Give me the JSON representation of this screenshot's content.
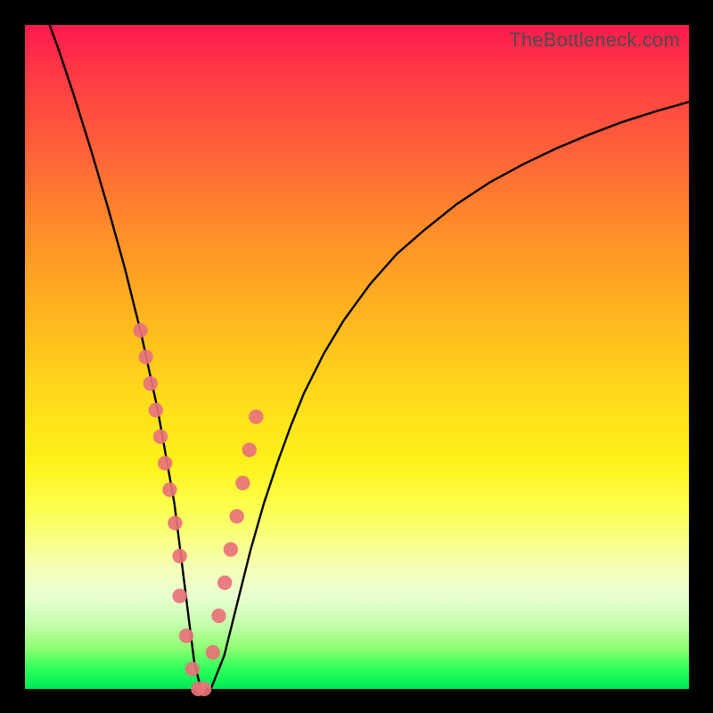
{
  "watermark": "TheBottleneck.com",
  "chart_data": {
    "type": "line",
    "title": "",
    "xlabel": "",
    "ylabel": "",
    "xlim": [
      0,
      100
    ],
    "ylim": [
      0,
      100
    ],
    "grid": false,
    "series": [
      {
        "name": "bottleneck-curve",
        "x": [
          3.7,
          5,
          7.5,
          10,
          12.5,
          15,
          17.5,
          20,
          22.5,
          23.5,
          24.5,
          25.5,
          26.5,
          28,
          30,
          32,
          34,
          36,
          38,
          40,
          42,
          45,
          48,
          52,
          56,
          60,
          65,
          70,
          75,
          80,
          85,
          90,
          95,
          100
        ],
        "y": [
          100,
          96.5,
          89,
          81,
          72.5,
          63.5,
          53.5,
          42,
          28,
          20,
          12,
          4,
          0,
          0,
          5,
          13,
          21,
          28,
          34,
          39.5,
          44.5,
          50.5,
          55.5,
          61,
          65.5,
          69,
          73,
          76.3,
          79,
          81.4,
          83.5,
          85.4,
          87,
          88.4
        ]
      }
    ],
    "points": {
      "name": "marked-points",
      "x": [
        17.4,
        18.2,
        18.9,
        19.7,
        20.4,
        21.1,
        21.8,
        22.6,
        23.3,
        23.3,
        24.3,
        25.2,
        26.1,
        27,
        28.3,
        29.2,
        30.1,
        31,
        31.9,
        32.8,
        33.8,
        34.8
      ],
      "y": [
        54,
        50,
        46,
        42,
        38,
        34,
        30,
        25,
        20,
        14,
        8,
        3,
        0,
        0,
        5.5,
        11,
        16,
        21,
        26,
        31,
        36,
        41
      ]
    }
  },
  "colors": {
    "curve_stroke": "#000000",
    "point_fill": "#e8727a"
  }
}
